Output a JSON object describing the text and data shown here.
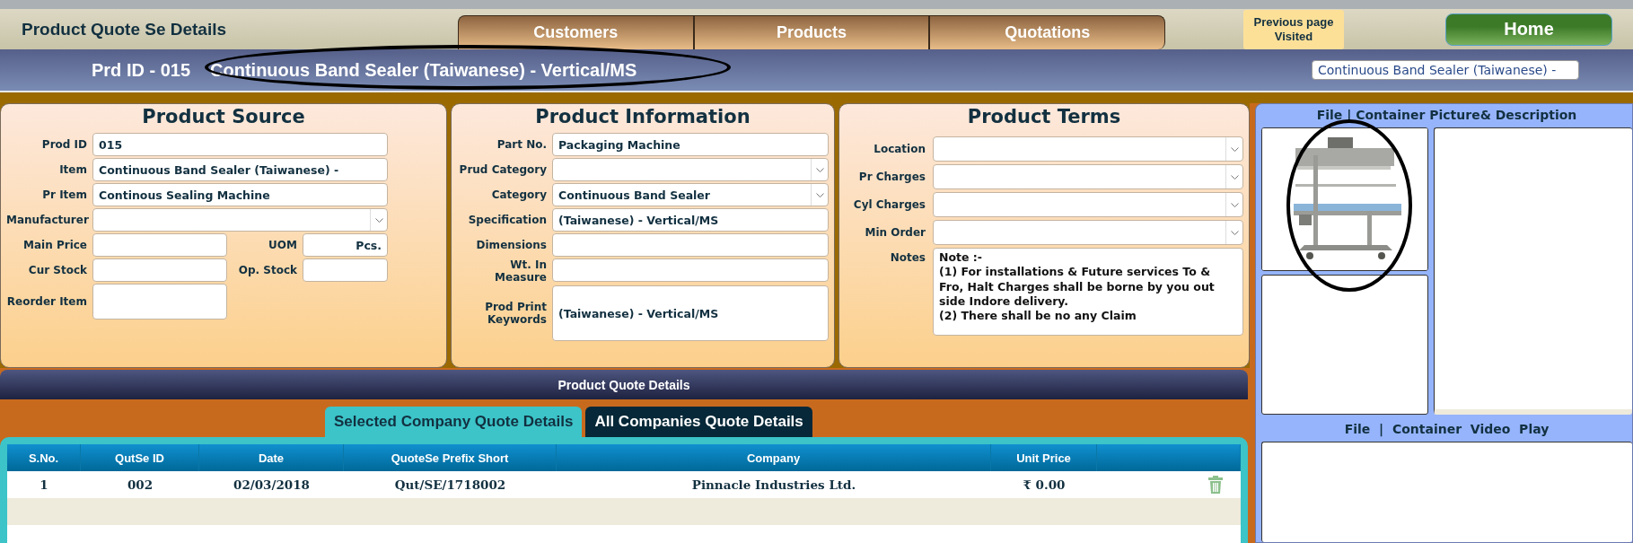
{
  "title": "Product Quote Se Details",
  "nav_tabs": [
    {
      "label": "Customers"
    },
    {
      "label": "Products"
    },
    {
      "label": "Quotations"
    }
  ],
  "previous_page": "Previous page Visited",
  "home": "Home",
  "product_bar": {
    "id_label": "Prd ID - 015",
    "name": "Continuous Band Sealer (Taiwanese) - Vertical/MS",
    "search_value": "Continuous Band Sealer (Taiwanese) -"
  },
  "product_source": {
    "title": "Product Source",
    "fields": [
      {
        "label": "Prod ID",
        "value": "015",
        "kind": "text"
      },
      {
        "label": "Item",
        "value": "Continuous Band Sealer (Taiwanese) -",
        "kind": "text"
      },
      {
        "label": "Pr Item",
        "value": "Continous Sealing Machine",
        "kind": "text"
      },
      {
        "label": "Manufacturer",
        "kind": "select"
      }
    ],
    "grid_fields": [
      {
        "label": "Main Price",
        "kind": "text"
      },
      {
        "label": "UOM",
        "value": "Pcs.",
        "kind": "text"
      },
      {
        "label": "Cur Stock",
        "kind": "text"
      },
      {
        "label": "Op. Stock",
        "kind": "text"
      },
      {
        "label": "Reorder Item",
        "kind": "area"
      }
    ]
  },
  "product_information": {
    "title": "Product Information",
    "fields": [
      {
        "label": "Part No.",
        "value": "Packaging Machine",
        "kind": "text"
      },
      {
        "label": "Prud Category",
        "kind": "select"
      },
      {
        "label": "Category",
        "value": "Continuous Band Sealer",
        "kind": "select"
      },
      {
        "label": "Specification",
        "value": "(Taiwanese) - Vertical/MS",
        "kind": "text"
      },
      {
        "label": "Dimensions",
        "kind": "text"
      },
      {
        "label": "Wt. In Measure",
        "kind": "text"
      },
      {
        "label": "Prod Print Keywords",
        "value": "(Taiwanese) - Vertical/MS",
        "kind": "area"
      }
    ]
  },
  "product_terms": {
    "title": "Product Terms",
    "fields": [
      {
        "label": "Location",
        "kind": "select"
      },
      {
        "label": "Pr Charges",
        "kind": "select"
      },
      {
        "label": "Cyl Charges",
        "kind": "select"
      },
      {
        "label": "Min Order",
        "kind": "select"
      }
    ],
    "notes": {
      "label": "Notes",
      "lines": [
        "Note :-",
        "(1) For installations & Future services To & Fro, Halt Charges shall be borne by you out side Indore delivery.",
        "(2) There shall be no any Claim"
      ]
    }
  },
  "quote_details": {
    "title": "Product Quote Details",
    "tabs": [
      {
        "label": "Selected Company Quote Details",
        "selected": true
      },
      {
        "label": "All Companies Quote Details",
        "selected": false
      }
    ],
    "columns": [
      "S.No.",
      "QutSe ID",
      "Date",
      "QuoteSe Prefix Short",
      "Company",
      "Unit Price"
    ],
    "rows": [
      {
        "cells": [
          "1",
          "002",
          "02/03/2018",
          "Qut/SE/1718002",
          "Pinnacle Industries Ltd.",
          "₹ 0.00"
        ]
      }
    ]
  },
  "media_panel": {
    "picture_title": "File | Container Picture& Description",
    "video_title": "File  |  Container  Video  Play"
  }
}
